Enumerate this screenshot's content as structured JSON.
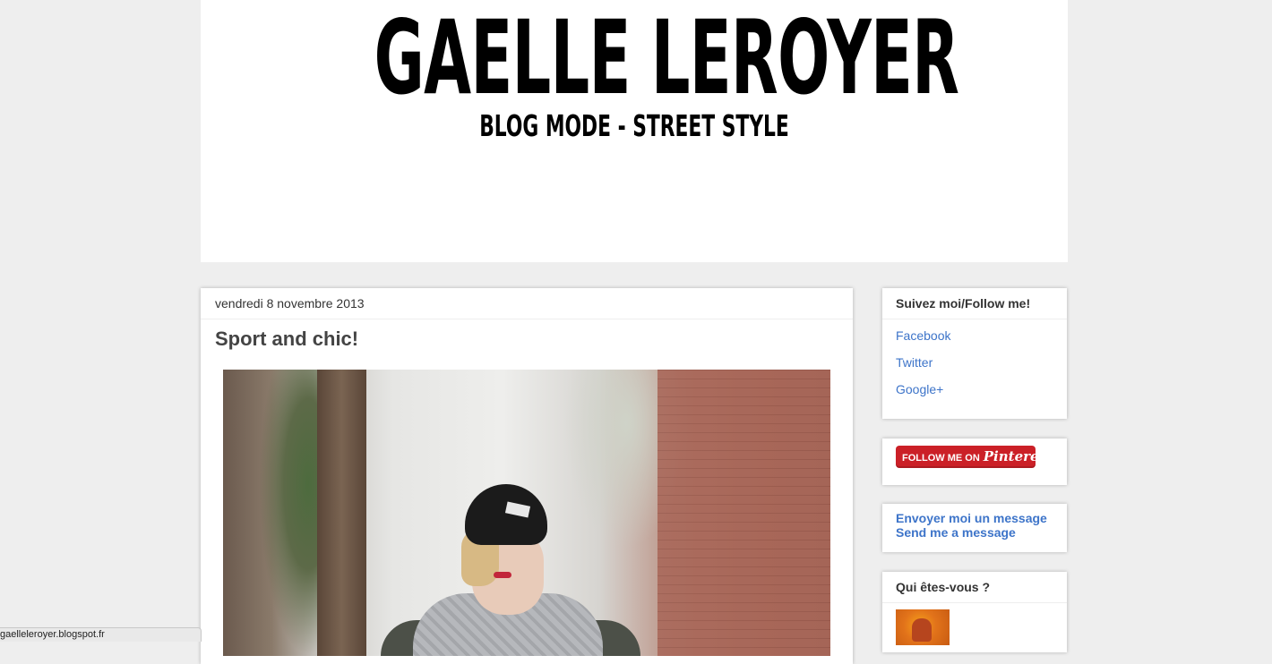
{
  "header": {
    "title": "GAELLE LEROYER",
    "subtitle": "BLOG MODE - STREET STYLE"
  },
  "post": {
    "date": "vendredi 8 novembre 2013",
    "title": "Sport and chic!"
  },
  "sidebar": {
    "follow": {
      "title": "Suivez moi/Follow me!",
      "links": [
        "Facebook",
        "Twitter",
        "Google+"
      ]
    },
    "pinterest": {
      "label": "FOLLOW ME ON",
      "brand": "Pinterest"
    },
    "message": {
      "line1": "Envoyer moi un message",
      "line2": "Send me a message"
    },
    "about": {
      "title": "Qui êtes-vous ?"
    }
  },
  "status_bar": {
    "url": "gaelleleroyer.blogspot.fr"
  },
  "colors": {
    "background": "#eeeeee",
    "link": "#3d74c9",
    "pinterest_red": "#cb2027"
  }
}
